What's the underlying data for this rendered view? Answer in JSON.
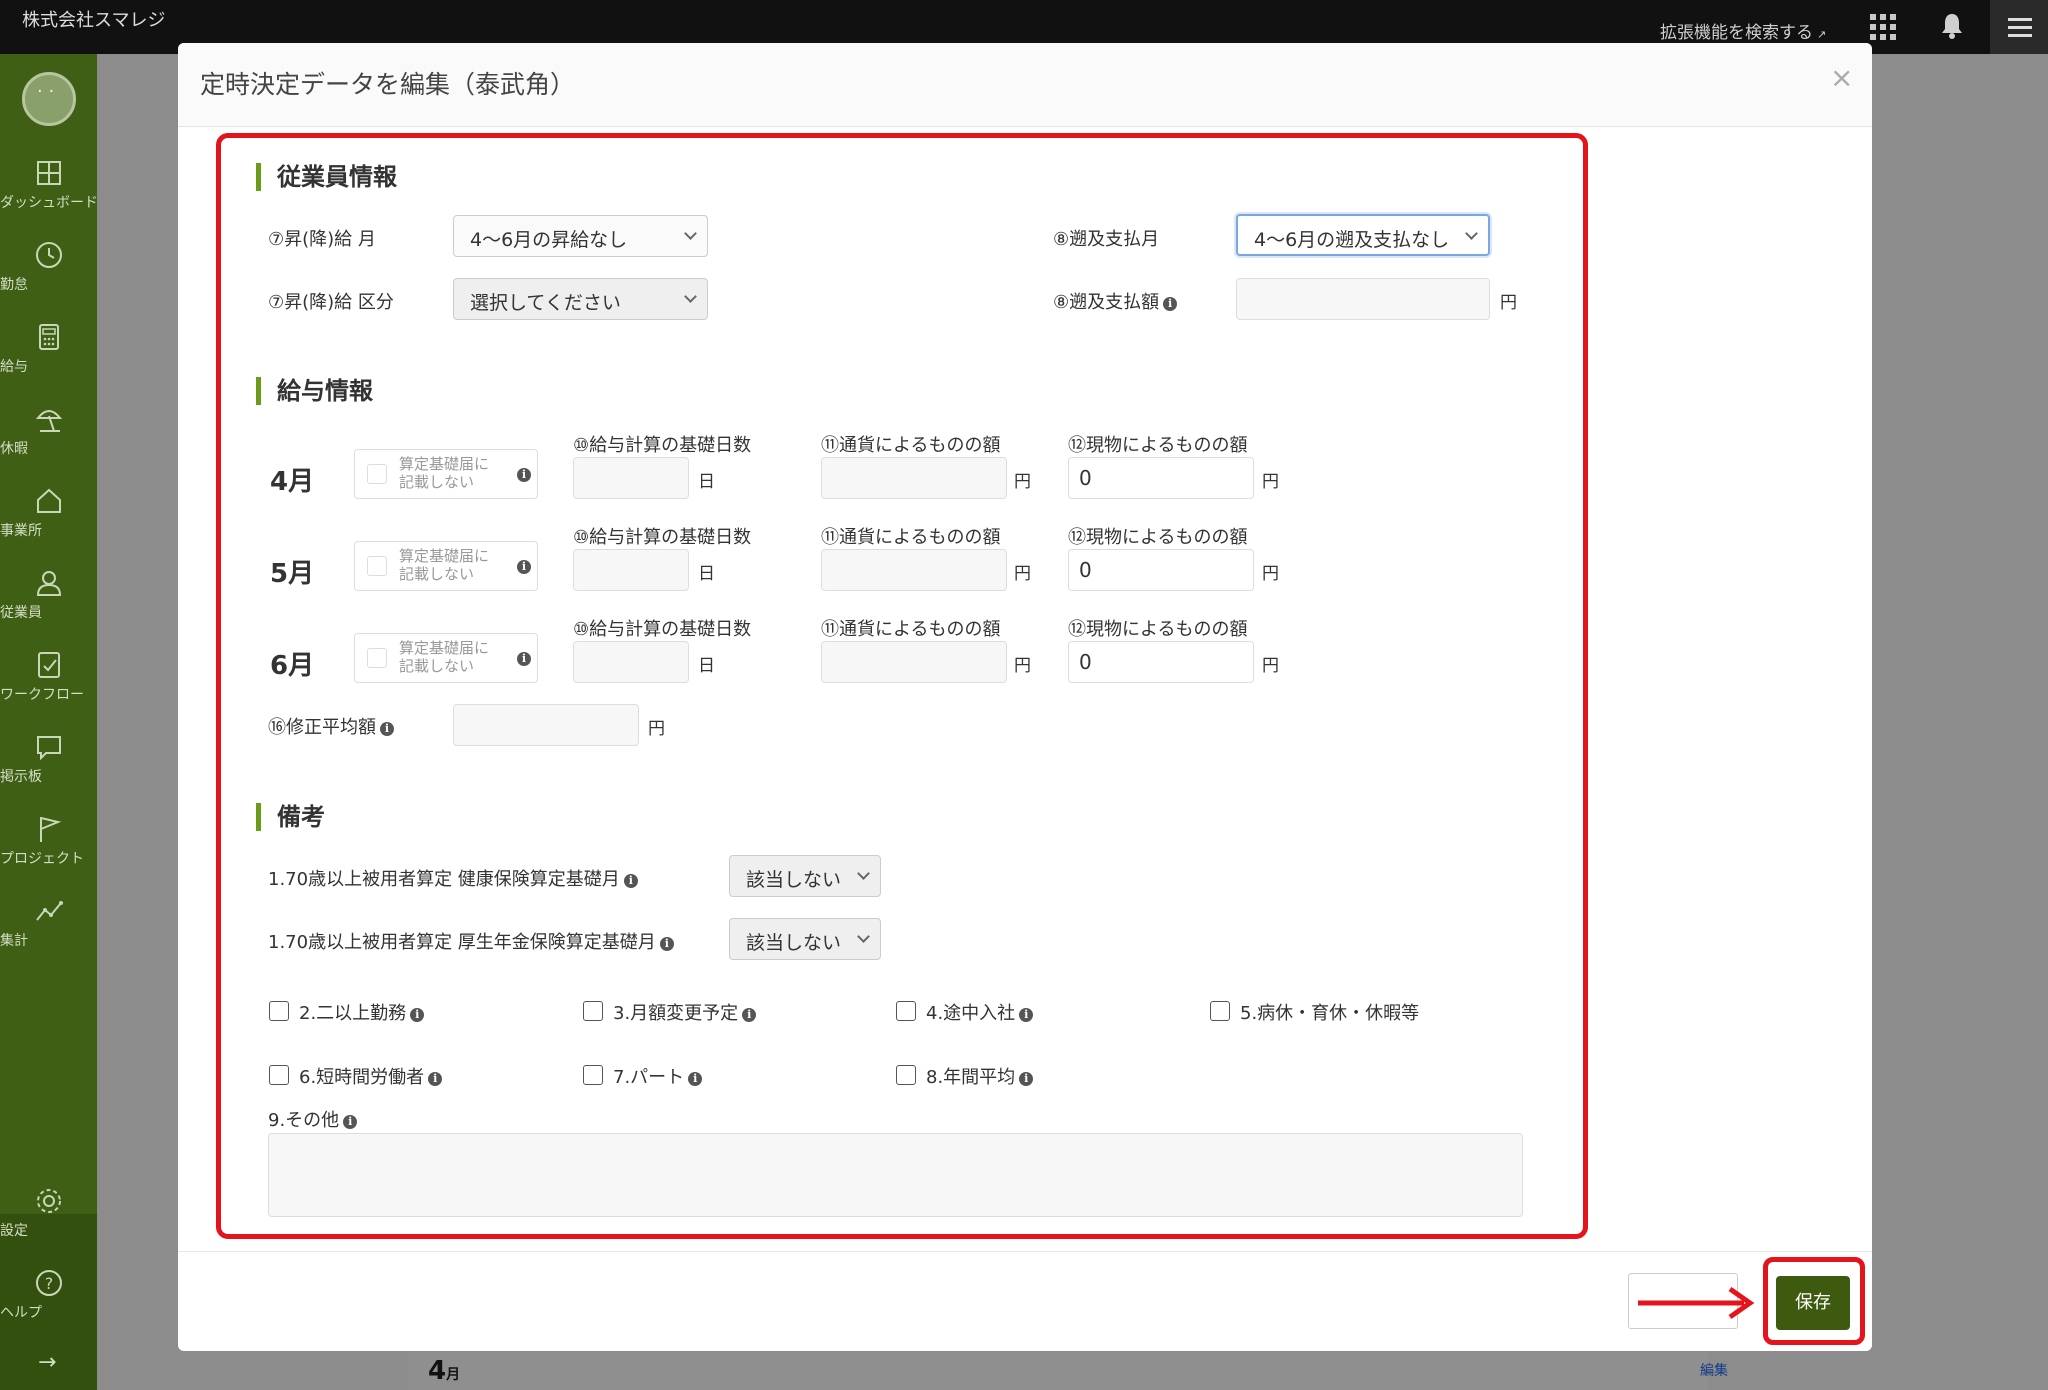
{
  "topbar": {
    "company": "株式会社スマレジ",
    "extension_search": "拡張機能を検索する",
    "icons": [
      "apps-grid-icon",
      "bell-icon",
      "hamburger-icon"
    ]
  },
  "sidebar": {
    "items": [
      {
        "icon": "dashboard-icon",
        "label": "ダッシュボード"
      },
      {
        "icon": "clock-icon",
        "label": "勤怠"
      },
      {
        "icon": "calculator-icon",
        "label": "給与"
      },
      {
        "icon": "beach-umbrella-icon",
        "label": "休暇"
      },
      {
        "icon": "house-icon",
        "label": "事業所"
      },
      {
        "icon": "person-icon",
        "label": "従業員"
      },
      {
        "icon": "checklist-icon",
        "label": "ワークフロー"
      },
      {
        "icon": "message-icon",
        "label": "掲示板"
      },
      {
        "icon": "flag-icon",
        "label": "プロジェクト"
      },
      {
        "icon": "line-chart-icon",
        "label": "集計"
      }
    ],
    "bottom_items": [
      {
        "icon": "gear-icon",
        "label": "設定"
      },
      {
        "icon": "help-icon",
        "label": "ヘルプ"
      }
    ],
    "arrow": "→"
  },
  "background": {
    "month": "4",
    "month_unit": "月",
    "edit_link": "編集"
  },
  "modal": {
    "title": "定時決定データを編集（泰武角）",
    "close": "×",
    "save_label": "保存",
    "employee_section": {
      "title": "従業員情報",
      "raise_month_label": "⑦昇(降)給 月",
      "raise_month_value": "4〜6月の昇給なし",
      "raise_type_label": "⑦昇(降)給 区分",
      "raise_type_value": "選択してください",
      "retro_month_label": "⑧遡及支払月",
      "retro_month_value": "4〜6月の遡及支払なし",
      "retro_amount_label": "⑧遡及支払額",
      "retro_amount_value": "",
      "yen": "円"
    },
    "salary_section": {
      "title": "給与情報",
      "checkbox_line1": "算定基礎届に",
      "checkbox_line2": "記載しない",
      "col_days": "⑩給与計算の基礎日数",
      "col_cash": "⑪通貨によるものの額",
      "col_goods": "⑫現物によるものの額",
      "day_unit": "日",
      "yen": "円",
      "months": [
        {
          "label": "4月",
          "days": "",
          "cash": "",
          "goods": "0"
        },
        {
          "label": "5月",
          "days": "",
          "cash": "",
          "goods": "0"
        },
        {
          "label": "6月",
          "days": "",
          "cash": "",
          "goods": "0"
        }
      ],
      "revised_avg_label": "⑯修正平均額",
      "revised_avg_value": ""
    },
    "remarks_section": {
      "title": "備考",
      "health_label": "1.70歳以上被用者算定 健康保険算定基礎月",
      "health_value": "該当しない",
      "pension_label": "1.70歳以上被用者算定 厚生年金保険算定基礎月",
      "pension_value": "該当しない",
      "checkboxes": [
        {
          "label": "2.二以上勤務",
          "info": true
        },
        {
          "label": "3.月額変更予定",
          "info": true
        },
        {
          "label": "4.途中入社",
          "info": true
        },
        {
          "label": "5.病休・育休・休暇等",
          "info": false
        },
        {
          "label": "6.短時間労働者",
          "info": true
        },
        {
          "label": "7.パート",
          "info": true
        },
        {
          "label": "8.年間平均",
          "info": true
        }
      ],
      "other_label": "9.その他",
      "other_value": ""
    }
  },
  "colors": {
    "sidebar": "#3f5f15",
    "accent_green": "#3d5a0e",
    "highlight_red": "#e3141b",
    "section_bar": "#6a9b1a"
  }
}
